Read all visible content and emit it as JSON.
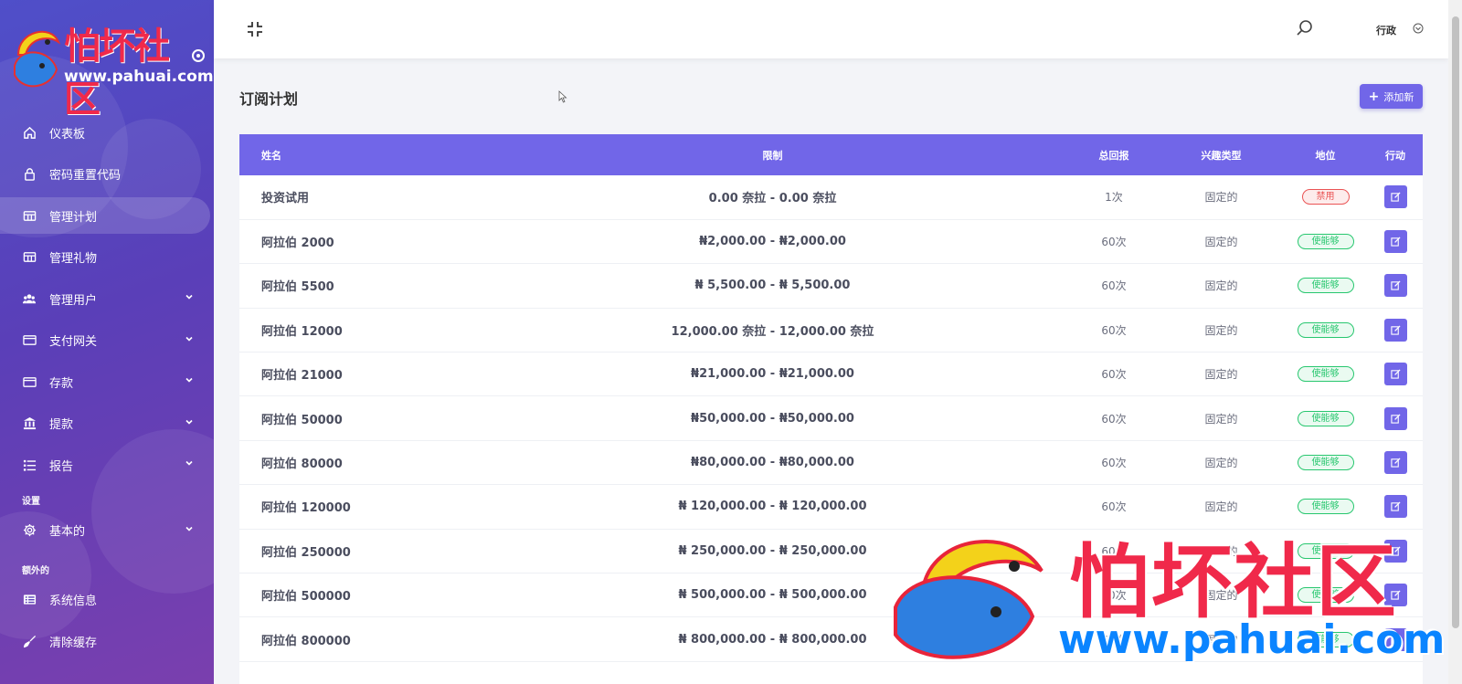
{
  "sidebar": {
    "logo": {
      "title": "怕坏社区",
      "url": "www.pahuai.com"
    },
    "items": [
      {
        "label": "仪表板",
        "icon": "home-icon"
      },
      {
        "label": "密码重置代码",
        "icon": "lock-icon"
      },
      {
        "label": "管理计划",
        "icon": "plan-icon",
        "active": true
      },
      {
        "label": "管理礼物",
        "icon": "gift-icon"
      },
      {
        "label": "管理用户",
        "icon": "users-icon",
        "has_children": true
      },
      {
        "label": "支付网关",
        "icon": "card-icon",
        "has_children": true
      },
      {
        "label": "存款",
        "icon": "wallet-icon",
        "has_children": true
      },
      {
        "label": "提款",
        "icon": "bank-icon",
        "has_children": true
      },
      {
        "label": "报告",
        "icon": "list-icon",
        "has_children": true
      }
    ],
    "settings_title": "设置",
    "settings_items": [
      {
        "label": "基本的",
        "icon": "gear-icon",
        "has_children": true
      }
    ],
    "extra_title": "额外的",
    "extra_items": [
      {
        "label": "系统信息",
        "icon": "server-icon"
      },
      {
        "label": "清除缓存",
        "icon": "broom-icon"
      }
    ]
  },
  "header": {
    "user_name": "行政"
  },
  "main": {
    "page_title": "订阅计划",
    "add_button_label": "添加新",
    "table": {
      "columns": [
        "姓名",
        "限制",
        "总回报",
        "兴趣类型",
        "地位",
        "行动"
      ],
      "rows": [
        {
          "name": "投资试用",
          "limit": "0.00 奈拉 - 0.00 奈拉",
          "return": "1次",
          "interest_type": "固定的",
          "status": "禁用",
          "status_color": "#ea5455"
        },
        {
          "name": "阿拉伯 2000",
          "limit": "₦2,000.00 - ₦2,000.00",
          "return": "60次",
          "interest_type": "固定的",
          "status": "使能够",
          "status_color": "#28c76f"
        },
        {
          "name": "阿拉伯 5500",
          "limit": "₦ 5,500.00 - ₦ 5,500.00",
          "return": "60次",
          "interest_type": "固定的",
          "status": "使能够",
          "status_color": "#28c76f"
        },
        {
          "name": "阿拉伯 12000",
          "limit": "12,000.00 奈拉 - 12,000.00 奈拉",
          "return": "60次",
          "interest_type": "固定的",
          "status": "使能够",
          "status_color": "#28c76f"
        },
        {
          "name": "阿拉伯 21000",
          "limit": "₦21,000.00 - ₦21,000.00",
          "return": "60次",
          "interest_type": "固定的",
          "status": "使能够",
          "status_color": "#28c76f"
        },
        {
          "name": "阿拉伯 50000",
          "limit": "₦50,000.00 - ₦50,000.00",
          "return": "60次",
          "interest_type": "固定的",
          "status": "使能够",
          "status_color": "#28c76f"
        },
        {
          "name": "阿拉伯 80000",
          "limit": "₦80,000.00 - ₦80,000.00",
          "return": "60次",
          "interest_type": "固定的",
          "status": "使能够",
          "status_color": "#28c76f"
        },
        {
          "name": "阿拉伯 120000",
          "limit": "₦ 120,000.00 - ₦ 120,000.00",
          "return": "60次",
          "interest_type": "固定的",
          "status": "使能够",
          "status_color": "#28c76f"
        },
        {
          "name": "阿拉伯 250000",
          "limit": "₦ 250,000.00 - ₦ 250,000.00",
          "return": "60次",
          "interest_type": "固定的",
          "status": "使能够",
          "status_color": "#28c76f"
        },
        {
          "name": "阿拉伯 500000",
          "limit": "₦ 500,000.00 - ₦ 500,000.00",
          "return": "60次",
          "interest_type": "固定的",
          "status": "使能够",
          "status_color": "#28c76f"
        },
        {
          "name": "阿拉伯 800000",
          "limit": "₦ 800,000.00 - ₦ 800,000.00",
          "return": "60次",
          "interest_type": "固定的",
          "status": "使能够",
          "status_color": "#28c76f"
        }
      ]
    }
  },
  "watermark": {
    "title": "怕坏社区",
    "url": "www.pahuai.com"
  },
  "colors": {
    "accent": "#7166e8",
    "sidebar_start": "#4f4fc9",
    "sidebar_end": "#7a3fae"
  }
}
